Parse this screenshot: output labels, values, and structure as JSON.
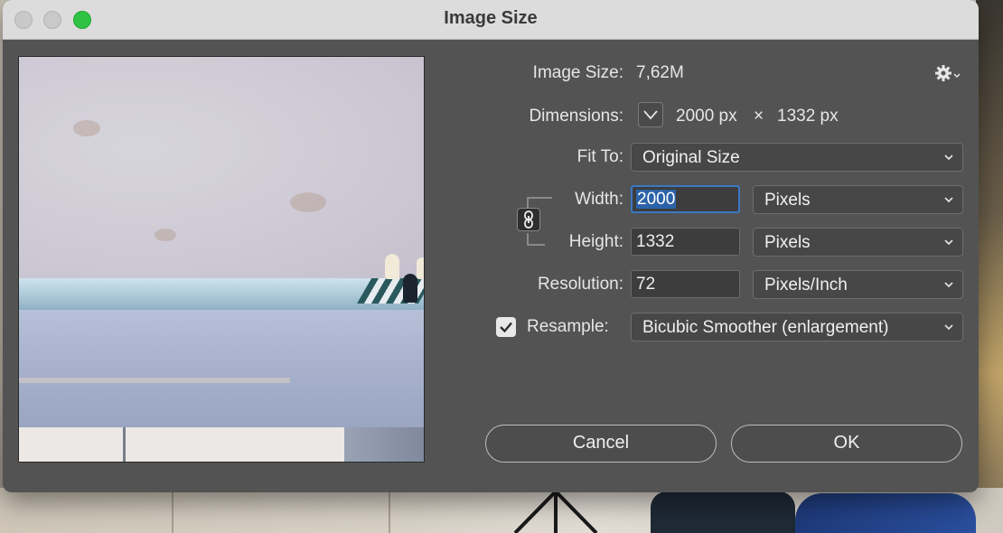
{
  "window": {
    "title": "Image Size"
  },
  "image_size": {
    "label": "Image Size:",
    "value": "7,62M"
  },
  "dimensions": {
    "label": "Dimensions:",
    "width_value": "2000 px",
    "times": "×",
    "height_value": "1332 px"
  },
  "fit_to": {
    "label": "Fit To:",
    "selected": "Original Size"
  },
  "width": {
    "label": "Width:",
    "value": "2000",
    "unit": "Pixels"
  },
  "height": {
    "label": "Height:",
    "value": "1332",
    "unit": "Pixels"
  },
  "resolution": {
    "label": "Resolution:",
    "value": "72",
    "unit": "Pixels/Inch"
  },
  "resample": {
    "label": "Resample:",
    "checked": true,
    "method": "Bicubic Smoother (enlargement)"
  },
  "buttons": {
    "cancel": "Cancel",
    "ok": "OK"
  },
  "icons": {
    "settings": "gear-icon",
    "dimensions_toggle": "chevron-down-icon",
    "constrain": "link-icon",
    "select_arrow": "chevron-down-icon",
    "checkbox": "checkmark-icon"
  },
  "colors": {
    "dialog_bg": "#535353",
    "focus": "#3a78c4",
    "selection": "#2b63a8",
    "traffic_green": "#2fc343"
  }
}
